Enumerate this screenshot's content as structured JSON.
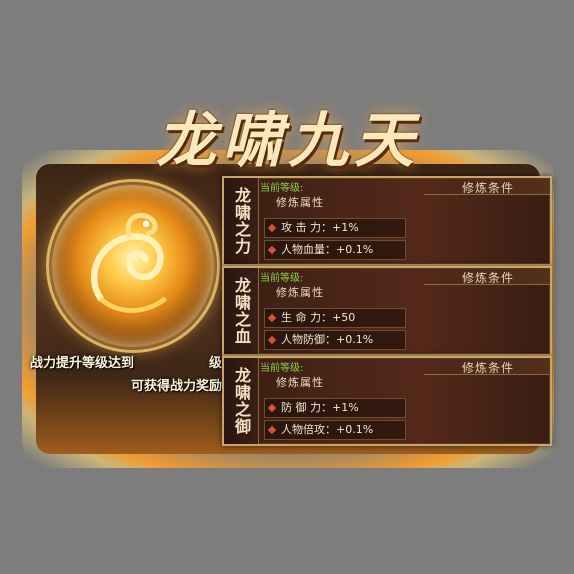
{
  "title": "龙啸九天",
  "promo": {
    "line1_left": "战力提升等级达到",
    "line1_right": "级",
    "line2": "可获得战力奖励"
  },
  "panels": [
    {
      "name": "龙啸之力",
      "current_level_label": "当前等级:",
      "condition_label": "修炼条件",
      "attr_header": "修炼属性",
      "rows": [
        "攻 击 力：+1%",
        "人物血量：+0.1%"
      ]
    },
    {
      "name": "龙啸之血",
      "current_level_label": "当前等级:",
      "condition_label": "修炼条件",
      "attr_header": "修炼属性",
      "rows": [
        "生 命 力：+50",
        "人物防御：+0.1%"
      ]
    },
    {
      "name": "龙啸之御",
      "current_level_label": "当前等级:",
      "condition_label": "修炼条件",
      "attr_header": "修炼属性",
      "rows": [
        "防 御 力：+1%",
        "人物倍攻：+0.1%"
      ]
    }
  ],
  "colors": {
    "background": "#7d7d7d",
    "current_level": "#8bd04a",
    "panel_border": "#c9a56a",
    "diamond": "#d6503a"
  },
  "icons": [
    "dragon-orb-icon",
    "diamond-bullet-icon"
  ]
}
